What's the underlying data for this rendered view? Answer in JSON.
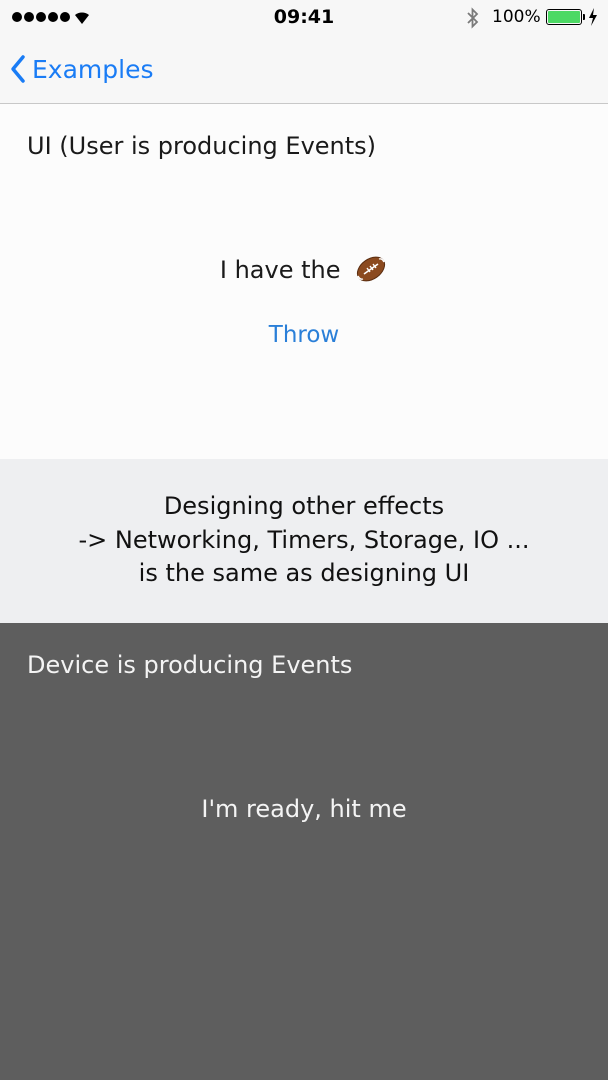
{
  "status_bar": {
    "time": "09:41",
    "battery_percent": "100%",
    "battery_level": 1.0,
    "signal_bars": 5,
    "icons": [
      "signal-dots-icon",
      "wifi-icon",
      "bluetooth-icon",
      "battery-icon",
      "charging-bolt-icon"
    ]
  },
  "nav": {
    "back_label": "Examples",
    "back_icon": "chevron-left-icon",
    "accent_color": "#1a7cf5"
  },
  "ui_section": {
    "title": "UI (User is producing Events)",
    "status_text": "I have the",
    "status_icon": "football-icon",
    "action_label": "Throw"
  },
  "info": {
    "line1": "Designing other effects",
    "line2": "-> Networking, Timers, Storage, IO ...",
    "line3": "is the same as designing UI"
  },
  "device_section": {
    "title": "Device is producing Events",
    "status_text": "I'm ready, hit me",
    "background_color": "#5e5e5e"
  }
}
